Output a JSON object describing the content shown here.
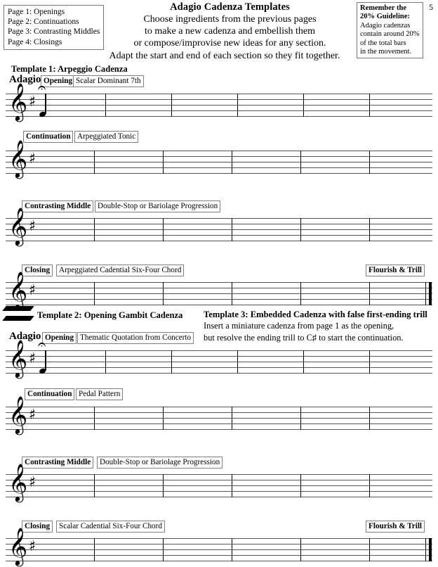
{
  "document": {
    "title": "Adagio Cadenza Templates",
    "page_number": "5",
    "subtitle_lines": [
      "Choose ingredients from the previous pages",
      "to make a new cadenza and embellish them",
      "or compose/improvise new ideas for any section.",
      "Adapt the start and end of each section so they fit together."
    ]
  },
  "index_box": {
    "items": [
      "Page 1: Openings",
      "Page 2: Continuations",
      "Page 3: Contrasting Middles",
      "Page 4: Closings"
    ]
  },
  "guideline_box": {
    "heading_line1": "Remember the",
    "heading_line2": "20% Guideline:",
    "body_lines": [
      "Adagio cadenzas",
      "contain around 20%",
      "of the total bars",
      "in the movement."
    ]
  },
  "templates": [
    {
      "heading": "Template 1: Arpeggio Cadenza",
      "tempo": "Adagio",
      "sections": [
        {
          "role": "Opening",
          "ingredient": "Scalar Dominant 7th",
          "end_label": null
        },
        {
          "role": "Continuation",
          "ingredient": "Arpeggiated Tonic",
          "end_label": null
        },
        {
          "role": "Contrasting Middle",
          "ingredient": "Double-Stop or Bariolage Progression",
          "end_label": null
        },
        {
          "role": "Closing",
          "ingredient": "Arpeggiated Cadential Six-Four Chord",
          "end_label": "Flourish & Trill"
        }
      ]
    },
    {
      "heading": "Template 2: Opening Gambit Cadenza",
      "tempo": "Adagio",
      "sections": [
        {
          "role": "Opening",
          "ingredient": "Thematic Quotation from Concerto",
          "end_label": null
        },
        {
          "role": "Continuation",
          "ingredient": "Pedal Pattern",
          "end_label": null
        },
        {
          "role": "Contrasting Middle",
          "ingredient": "Double-Stop or Bariolage Progression",
          "end_label": null
        },
        {
          "role": "Closing",
          "ingredient": "Scalar Cadential Six-Four Chord",
          "end_label": "Flourish & Trill"
        }
      ]
    }
  ],
  "template3": {
    "heading": "Template 3: Embedded Cadenza with false first-ending trill",
    "body_lines": [
      "Insert a miniature cadenza from page 1 as the opening,",
      "but resolve the ending trill to C♯ to start the continuation."
    ]
  },
  "notation": {
    "clef_glyph": "𝄞",
    "sharp_glyph": "♯",
    "fermata_glyph": "𝄐"
  }
}
